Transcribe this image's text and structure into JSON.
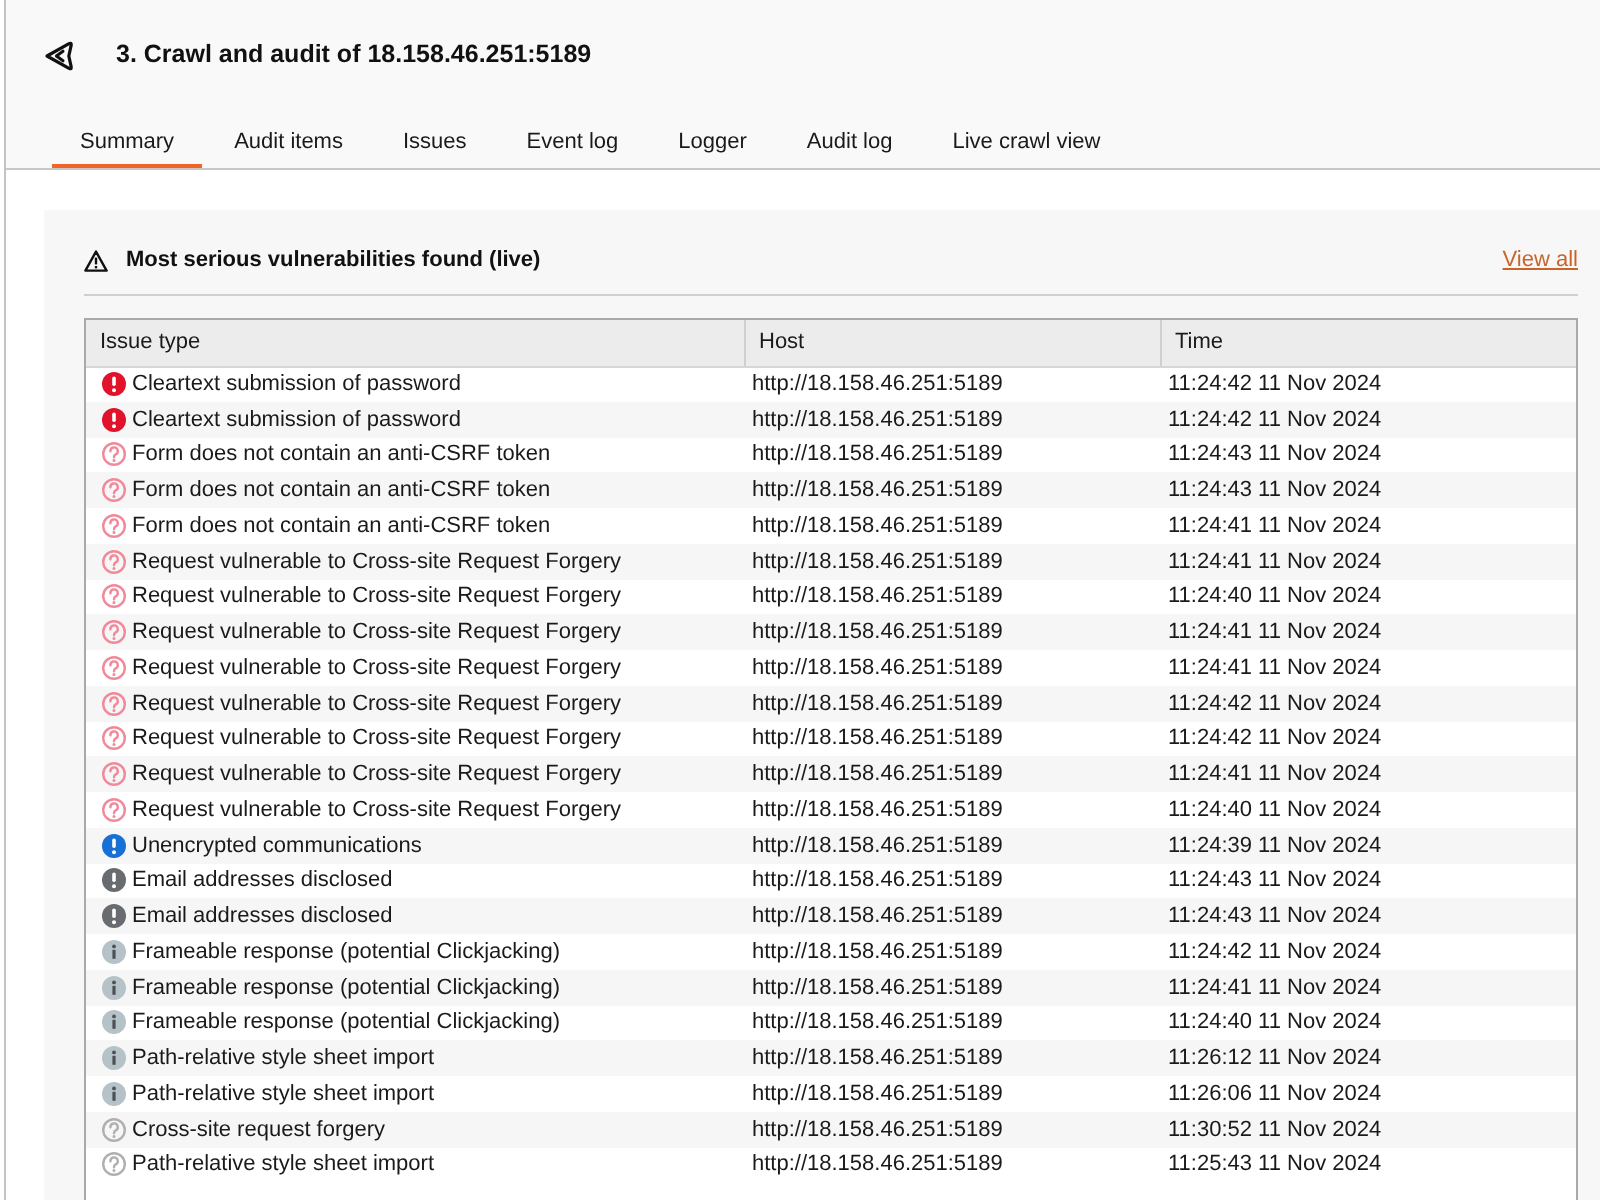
{
  "header": {
    "title": "3. Crawl and audit of 18.158.46.251:5189"
  },
  "tabs": [
    {
      "label": "Summary",
      "selected": true
    },
    {
      "label": "Audit items",
      "selected": false
    },
    {
      "label": "Issues",
      "selected": false
    },
    {
      "label": "Event log",
      "selected": false
    },
    {
      "label": "Logger",
      "selected": false
    },
    {
      "label": "Audit log",
      "selected": false
    },
    {
      "label": "Live crawl view",
      "selected": false
    }
  ],
  "panel": {
    "title": "Most serious vulnerabilities found (live)",
    "link": "View all",
    "table": {
      "columns": [
        "Issue type",
        "Host",
        "Time"
      ],
      "rows": [
        {
          "kind": "certain",
          "color": "#e1132b",
          "issue": "Cleartext submission of password",
          "host": "http://18.158.46.251:5189",
          "time": "11:24:42 11 Nov 2024"
        },
        {
          "kind": "certain",
          "color": "#e1132b",
          "issue": "Cleartext submission of password",
          "host": "http://18.158.46.251:5189",
          "time": "11:24:42 11 Nov 2024"
        },
        {
          "kind": "tentative",
          "color": "#f2899a",
          "issue": "Form does not contain an anti-CSRF token",
          "host": "http://18.158.46.251:5189",
          "time": "11:24:43 11 Nov 2024"
        },
        {
          "kind": "tentative",
          "color": "#f2899a",
          "issue": "Form does not contain an anti-CSRF token",
          "host": "http://18.158.46.251:5189",
          "time": "11:24:43 11 Nov 2024"
        },
        {
          "kind": "tentative",
          "color": "#f2899a",
          "issue": "Form does not contain an anti-CSRF token",
          "host": "http://18.158.46.251:5189",
          "time": "11:24:41 11 Nov 2024"
        },
        {
          "kind": "tentative",
          "color": "#f2899a",
          "issue": "Request vulnerable to Cross-site Request Forgery",
          "host": "http://18.158.46.251:5189",
          "time": "11:24:41 11 Nov 2024"
        },
        {
          "kind": "tentative",
          "color": "#f2899a",
          "issue": "Request vulnerable to Cross-site Request Forgery",
          "host": "http://18.158.46.251:5189",
          "time": "11:24:40 11 Nov 2024"
        },
        {
          "kind": "tentative",
          "color": "#f2899a",
          "issue": "Request vulnerable to Cross-site Request Forgery",
          "host": "http://18.158.46.251:5189",
          "time": "11:24:41 11 Nov 2024"
        },
        {
          "kind": "tentative",
          "color": "#f2899a",
          "issue": "Request vulnerable to Cross-site Request Forgery",
          "host": "http://18.158.46.251:5189",
          "time": "11:24:41 11 Nov 2024"
        },
        {
          "kind": "tentative",
          "color": "#f2899a",
          "issue": "Request vulnerable to Cross-site Request Forgery",
          "host": "http://18.158.46.251:5189",
          "time": "11:24:42 11 Nov 2024"
        },
        {
          "kind": "tentative",
          "color": "#f2899a",
          "issue": "Request vulnerable to Cross-site Request Forgery",
          "host": "http://18.158.46.251:5189",
          "time": "11:24:42 11 Nov 2024"
        },
        {
          "kind": "tentative",
          "color": "#f2899a",
          "issue": "Request vulnerable to Cross-site Request Forgery",
          "host": "http://18.158.46.251:5189",
          "time": "11:24:41 11 Nov 2024"
        },
        {
          "kind": "tentative",
          "color": "#f2899a",
          "issue": "Request vulnerable to Cross-site Request Forgery",
          "host": "http://18.158.46.251:5189",
          "time": "11:24:40 11 Nov 2024"
        },
        {
          "kind": "certain",
          "color": "#1670d6",
          "issue": "Unencrypted communications",
          "host": "http://18.158.46.251:5189",
          "time": "11:24:39 11 Nov 2024"
        },
        {
          "kind": "certain",
          "color": "#686b6f",
          "issue": "Email addresses disclosed",
          "host": "http://18.158.46.251:5189",
          "time": "11:24:43 11 Nov 2024"
        },
        {
          "kind": "certain",
          "color": "#686b6f",
          "issue": "Email addresses disclosed",
          "host": "http://18.158.46.251:5189",
          "time": "11:24:43 11 Nov 2024"
        },
        {
          "kind": "firm",
          "color": "#b5c2c8",
          "issue": "Frameable response (potential Clickjacking)",
          "host": "http://18.158.46.251:5189",
          "time": "11:24:42 11 Nov 2024"
        },
        {
          "kind": "firm",
          "color": "#b5c2c8",
          "issue": "Frameable response (potential Clickjacking)",
          "host": "http://18.158.46.251:5189",
          "time": "11:24:41 11 Nov 2024"
        },
        {
          "kind": "firm",
          "color": "#b5c2c8",
          "issue": "Frameable response (potential Clickjacking)",
          "host": "http://18.158.46.251:5189",
          "time": "11:24:40 11 Nov 2024"
        },
        {
          "kind": "firm",
          "color": "#b5c2c8",
          "issue": "Path-relative style sheet import",
          "host": "http://18.158.46.251:5189",
          "time": "11:26:12 11 Nov 2024"
        },
        {
          "kind": "firm",
          "color": "#b5c2c8",
          "issue": "Path-relative style sheet import",
          "host": "http://18.158.46.251:5189",
          "time": "11:26:06 11 Nov 2024"
        },
        {
          "kind": "tentative",
          "color": "#b0b0b0",
          "issue": "Cross-site request forgery",
          "host": "http://18.158.46.251:5189",
          "time": "11:30:52 11 Nov 2024"
        },
        {
          "kind": "tentative",
          "color": "#b0b0b0",
          "issue": "Path-relative style sheet import",
          "host": "http://18.158.46.251:5189",
          "time": "11:25:43 11 Nov 2024"
        }
      ]
    }
  }
}
